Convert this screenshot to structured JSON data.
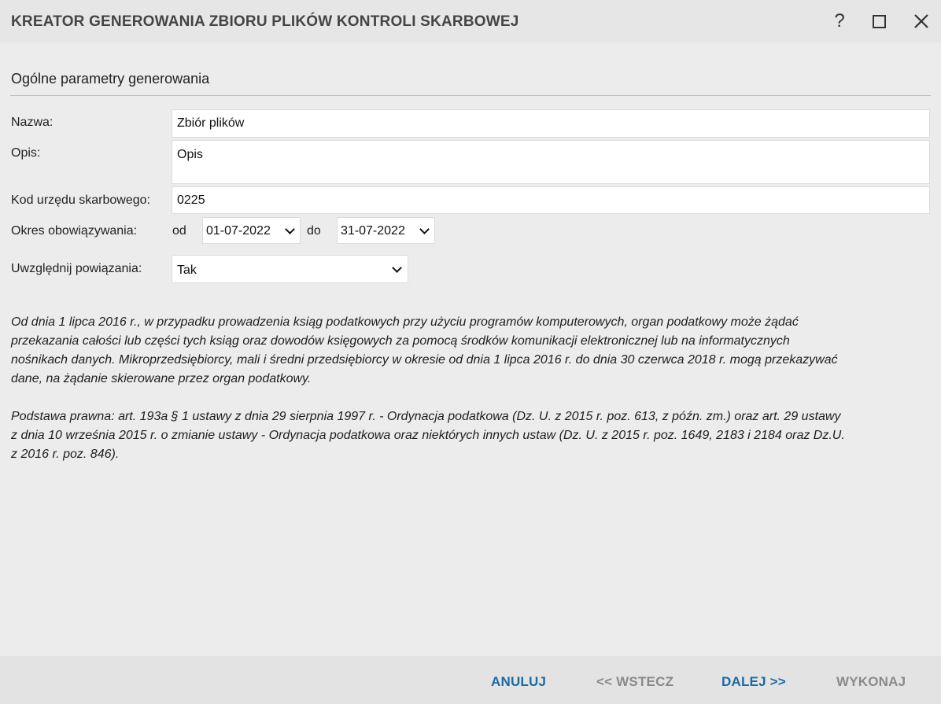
{
  "window": {
    "title": "KREATOR GENEROWANIA ZBIORU PLIKÓW KONTROLI SKARBOWEJ",
    "help_label": "?"
  },
  "section": {
    "title": "Ogólne parametry generowania"
  },
  "form": {
    "name_label": "Nazwa:",
    "name_value": "Zbiór plików",
    "desc_label": "Opis:",
    "desc_value": "Opis",
    "office_label": "Kod urzędu skarbowego:",
    "office_value": "0225",
    "period_label": "Okres obowiązywania:",
    "from_label": "od",
    "from_value": "01-07-2022",
    "to_label": "do",
    "to_value": "31-07-2022",
    "relations_label": "Uwzględnij powiązania:",
    "relations_value": "Tak"
  },
  "info": {
    "paragraph1_lines": [
      "Od dnia 1 lipca 2016 r., w przypadku prowadzenia ksiąg podatkowych przy użyciu programów komputerowych, organ podatkowy może żądać",
      "przekazania całości lub części tych ksiąg oraz dowodów księgowych za pomocą środków komunikacji elektronicznej lub na informatycznych",
      "nośnikach danych. Mikroprzedsiębiorcy, mali i średni przedsiębiorcy w okresie od dnia 1 lipca 2016 r. do dnia 30 czerwca 2018 r. mogą przekazywać",
      "dane, na żądanie skierowane przez organ podatkowy."
    ],
    "paragraph2_lines": [
      "Podstawa prawna: art. 193a § 1 ustawy z dnia 29 sierpnia 1997 r. - Ordynacja podatkowa (Dz. U. z 2015 r. poz. 613, z późn. zm.) oraz art. 29 ustawy",
      "z dnia 10 września 2015 r. o zmianie ustawy - Ordynacja podatkowa oraz niektórych innych ustaw (Dz. U. z 2015 r. poz. 1649, 2183 i 2184 oraz Dz.U.",
      "z 2016 r. poz. 846)."
    ]
  },
  "footer": {
    "cancel_label": "ANULUJ",
    "back_label": "<< WSTECZ",
    "next_label": "DALEJ >>",
    "execute_label": "WYKONAJ"
  },
  "colors": {
    "active_button": "#1a6aa5",
    "disabled_button": "#8a8a8a"
  }
}
